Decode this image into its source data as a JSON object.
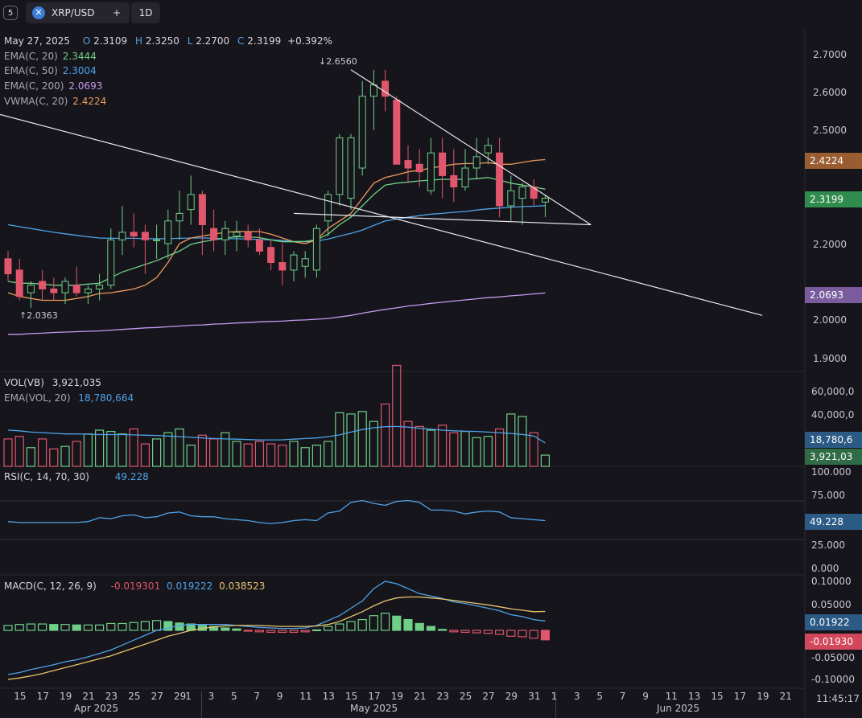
{
  "toolbar": {
    "layout_label": "5",
    "symbol": "XRP/USD",
    "add_label": "+",
    "interval": "1D"
  },
  "header": {
    "date": "May 27, 2025",
    "o_label": "O",
    "o": "2.3109",
    "h_label": "H",
    "h": "2.3250",
    "l_label": "L",
    "l": "2.2700",
    "c_label": "C",
    "c": "2.3199",
    "change": "+0.392%"
  },
  "indicators": [
    {
      "label": "EMA(C, 20)",
      "value": "2.3444",
      "color": "#6fcf86"
    },
    {
      "label": "EMA(C, 50)",
      "value": "2.3004",
      "color": "#4ea3e8"
    },
    {
      "label": "EMA(C, 200)",
      "value": "2.0693",
      "color": "#c59bf0"
    },
    {
      "label": "VWMA(C, 20)",
      "value": "2.4224",
      "color": "#ee9a5a"
    }
  ],
  "annotations": {
    "high": "↓2.6560",
    "low": "↑2.0363"
  },
  "price_axis": [
    "2.7000",
    "2.6000",
    "2.5000",
    "2.4000",
    "2.3000",
    "2.2000",
    "2.1000",
    "2.0000",
    "1.9000"
  ],
  "price_labels": [
    {
      "text": "2.4224",
      "color": "#9a5d31"
    },
    {
      "text": "2.3199",
      "color": "#2f8c4e"
    },
    {
      "text": "2.0693",
      "color": "#7a5c9e"
    }
  ],
  "volume": {
    "label": "VOL(VB)",
    "value": "3,921,035",
    "ema_label": "EMA(VOL, 20)",
    "ema_value": "18,780,664",
    "axis": [
      "60,000,0",
      "40,000,0"
    ],
    "tag_ema": "18,780,6",
    "tag_vol": "3,921,03",
    "tag_ema_color": "#2b5a85",
    "tag_vol_color": "#2f6b45"
  },
  "rsi": {
    "label": "RSI(C, 14, 70, 30)",
    "value": "49.228",
    "axis": [
      "100.000",
      "75.000",
      "50.000",
      "25.000",
      "0.000"
    ],
    "tag": "49.228",
    "tag_color": "#2b5a85"
  },
  "macd": {
    "label": "MACD(C, 12, 26, 9)",
    "v1": "-0.019301",
    "v2": "0.019222",
    "v3": "0.038523",
    "axis": [
      "0.10000",
      "0.05000",
      "0.00000",
      "-0.05000",
      "-0.10000"
    ],
    "tag_pos": "0.01922",
    "tag_neg": "-0.01930",
    "tag_pos_color": "#2b5a85",
    "tag_neg_color": "#d3475c"
  },
  "x_axis": {
    "days": [
      "15",
      "17",
      "19",
      "21",
      "23",
      "25",
      "27",
      "29",
      "1",
      "3",
      "5",
      "7",
      "9",
      "11",
      "13",
      "15",
      "17",
      "19",
      "21",
      "23",
      "25",
      "27",
      "29",
      "31",
      "1",
      "3",
      "5",
      "7",
      "9",
      "11",
      "13",
      "15",
      "17",
      "19",
      "21"
    ],
    "months": [
      "Apr 2025",
      "May 2025",
      "Jun 2025"
    ],
    "time": "11:45:17"
  },
  "colors": {
    "up": "#6fcf86",
    "down": "#e0566d",
    "trendline": "#e8e8ee"
  },
  "chart_data": {
    "type": "candlestick",
    "symbol": "XRP/USD",
    "interval": "1D",
    "x_start": "2025-04-14",
    "ohlc": [
      [
        2.16,
        2.18,
        2.1,
        2.12
      ],
      [
        2.13,
        2.16,
        2.05,
        2.06
      ],
      [
        2.07,
        2.1,
        2.03,
        2.09
      ],
      [
        2.1,
        2.13,
        2.05,
        2.08
      ],
      [
        2.08,
        2.11,
        2.05,
        2.07
      ],
      [
        2.07,
        2.11,
        2.04,
        2.1
      ],
      [
        2.09,
        2.14,
        2.06,
        2.07
      ],
      [
        2.07,
        2.09,
        2.04,
        2.08
      ],
      [
        2.08,
        2.12,
        2.05,
        2.09
      ],
      [
        2.09,
        2.24,
        2.08,
        2.21
      ],
      [
        2.21,
        2.3,
        2.17,
        2.23
      ],
      [
        2.23,
        2.28,
        2.19,
        2.22
      ],
      [
        2.23,
        2.25,
        2.12,
        2.21
      ],
      [
        2.21,
        2.25,
        2.16,
        2.21
      ],
      [
        2.2,
        2.29,
        2.16,
        2.26
      ],
      [
        2.26,
        2.34,
        2.21,
        2.28
      ],
      [
        2.29,
        2.38,
        2.25,
        2.33
      ],
      [
        2.33,
        2.34,
        2.17,
        2.25
      ],
      [
        2.24,
        2.29,
        2.18,
        2.21
      ],
      [
        2.21,
        2.26,
        2.17,
        2.24
      ],
      [
        2.22,
        2.26,
        2.18,
        2.23
      ],
      [
        2.23,
        2.25,
        2.19,
        2.21
      ],
      [
        2.21,
        2.24,
        2.17,
        2.18
      ],
      [
        2.19,
        2.21,
        2.13,
        2.15
      ],
      [
        2.15,
        2.2,
        2.09,
        2.13
      ],
      [
        2.13,
        2.18,
        2.1,
        2.17
      ],
      [
        2.14,
        2.18,
        2.11,
        2.16
      ],
      [
        2.13,
        2.25,
        2.11,
        2.24
      ],
      [
        2.26,
        2.34,
        2.22,
        2.33
      ],
      [
        2.33,
        2.49,
        2.3,
        2.48
      ],
      [
        2.32,
        2.49,
        2.29,
        2.48
      ],
      [
        2.4,
        2.63,
        2.38,
        2.59
      ],
      [
        2.59,
        2.66,
        2.5,
        2.62
      ],
      [
        2.63,
        2.66,
        2.55,
        2.59
      ],
      [
        2.58,
        2.59,
        2.41,
        2.41
      ],
      [
        2.42,
        2.46,
        2.36,
        2.4
      ],
      [
        2.41,
        2.45,
        2.35,
        2.39
      ],
      [
        2.34,
        2.48,
        2.33,
        2.44
      ],
      [
        2.44,
        2.48,
        2.32,
        2.38
      ],
      [
        2.38,
        2.45,
        2.31,
        2.35
      ],
      [
        2.35,
        2.45,
        2.34,
        2.4
      ],
      [
        2.4,
        2.48,
        2.37,
        2.43
      ],
      [
        2.44,
        2.48,
        2.41,
        2.46
      ],
      [
        2.44,
        2.48,
        2.27,
        2.3
      ],
      [
        2.3,
        2.38,
        2.26,
        2.34
      ],
      [
        2.32,
        2.36,
        2.25,
        2.35
      ],
      [
        2.35,
        2.37,
        2.3,
        2.32
      ],
      [
        2.31,
        2.33,
        2.27,
        2.32
      ]
    ],
    "overlays": {
      "ema20": [
        2.1,
        2.095,
        2.095,
        2.093,
        2.09,
        2.09,
        2.09,
        2.093,
        2.095,
        2.11,
        2.125,
        2.135,
        2.145,
        2.155,
        2.168,
        2.18,
        2.198,
        2.205,
        2.21,
        2.215,
        2.218,
        2.218,
        2.216,
        2.21,
        2.205,
        2.205,
        2.206,
        2.21,
        2.225,
        2.25,
        2.27,
        2.3,
        2.33,
        2.355,
        2.36,
        2.363,
        2.366,
        2.368,
        2.37,
        2.37,
        2.37,
        2.372,
        2.375,
        2.368,
        2.36,
        2.355,
        2.35,
        2.344
      ],
      "ema50": [
        2.25,
        2.245,
        2.24,
        2.235,
        2.23,
        2.226,
        2.222,
        2.218,
        2.215,
        2.214,
        2.214,
        2.214,
        2.213,
        2.213,
        2.213,
        2.214,
        2.215,
        2.215,
        2.214,
        2.213,
        2.213,
        2.212,
        2.211,
        2.21,
        2.208,
        2.206,
        2.205,
        2.207,
        2.212,
        2.22,
        2.227,
        2.236,
        2.248,
        2.26,
        2.265,
        2.27,
        2.274,
        2.278,
        2.28,
        2.283,
        2.285,
        2.289,
        2.292,
        2.294,
        2.296,
        2.298,
        2.299,
        2.3004
      ],
      "ema200": [
        1.96,
        1.96,
        1.962,
        1.963,
        1.965,
        1.966,
        1.967,
        1.968,
        1.969,
        1.971,
        1.973,
        1.975,
        1.977,
        1.978,
        1.98,
        1.982,
        1.984,
        1.985,
        1.987,
        1.988,
        1.99,
        1.991,
        1.993,
        1.994,
        1.995,
        1.997,
        1.998,
        2.0,
        2.002,
        2.006,
        2.01,
        2.016,
        2.021,
        2.026,
        2.03,
        2.035,
        2.038,
        2.042,
        2.045,
        2.048,
        2.051,
        2.054,
        2.057,
        2.059,
        2.062,
        2.064,
        2.067,
        2.0693
      ],
      "vwma20": [
        2.07,
        2.06,
        2.055,
        2.05,
        2.05,
        2.05,
        2.055,
        2.06,
        2.068,
        2.07,
        2.075,
        2.08,
        2.09,
        2.11,
        2.15,
        2.2,
        2.215,
        2.22,
        2.225,
        2.23,
        2.232,
        2.232,
        2.232,
        2.225,
        2.215,
        2.205,
        2.2,
        2.21,
        2.24,
        2.26,
        2.28,
        2.32,
        2.36,
        2.375,
        2.382,
        2.39,
        2.394,
        2.4,
        2.405,
        2.41,
        2.412,
        2.412,
        2.414,
        2.41,
        2.41,
        2.415,
        2.42,
        2.4224
      ]
    },
    "trendlines": [
      {
        "from": [
          "2025-04-06",
          2.6
        ],
        "to": [
          "2025-06-19",
          2.01
        ]
      },
      {
        "from": [
          "2025-05-14",
          2.66
        ],
        "to": [
          "2025-06-04",
          2.25
        ]
      },
      {
        "from": [
          "2025-05-09",
          2.28
        ],
        "to": [
          "2025-06-04",
          2.25
        ]
      }
    ],
    "volume": [
      22,
      24,
      15,
      22,
      14,
      16,
      20,
      26,
      29,
      28,
      26,
      30,
      18,
      22,
      27,
      30,
      17,
      25,
      22,
      27,
      20,
      18,
      20,
      18,
      17,
      20,
      15,
      17,
      20,
      43,
      42,
      44,
      36,
      50,
      81,
      36,
      32,
      29,
      33,
      27,
      28,
      23,
      24,
      30,
      42,
      40,
      27,
      9
    ],
    "volume_ema": [
      29,
      28.5,
      27.5,
      27,
      26.5,
      26,
      26,
      25.8,
      25.5,
      25.5,
      25.5,
      25.2,
      25,
      24.8,
      24.3,
      23.8,
      23.3,
      22.8,
      22.3,
      22,
      21.8,
      21.5,
      21.2,
      21.2,
      21.3,
      21.8,
      22.3,
      22.8,
      23.8,
      25.2,
      27.5,
      29.5,
      31,
      31.8,
      32,
      31.5,
      30.5,
      29.8,
      29,
      28.5,
      28.2,
      28,
      27.5,
      27,
      26.3,
      25.6,
      24.4,
      18.78
    ],
    "volume_unit": "millions",
    "rsi": [
      49,
      48,
      48,
      48,
      48,
      48,
      48,
      49,
      53,
      52,
      55,
      56,
      53,
      54,
      58,
      59,
      55,
      54,
      54,
      52,
      51,
      50,
      48,
      47,
      48,
      50,
      51,
      50,
      58,
      60,
      69,
      71,
      68,
      66,
      70,
      71,
      69,
      61,
      61,
      60,
      57,
      59,
      60,
      59,
      53,
      52,
      51,
      50,
      49.2
    ],
    "macd": [
      -0.09,
      -0.086,
      -0.08,
      -0.075,
      -0.07,
      -0.064,
      -0.06,
      -0.054,
      -0.047,
      -0.04,
      -0.03,
      -0.02,
      -0.01,
      0,
      0.005,
      0.01,
      0.012,
      0.012,
      0.012,
      0.012,
      0.01,
      0.008,
      0.006,
      0.005,
      0.004,
      0.004,
      0.005,
      0.01,
      0.02,
      0.03,
      0.045,
      0.06,
      0.085,
      0.1,
      0.095,
      0.085,
      0.075,
      0.07,
      0.065,
      0.058,
      0.055,
      0.05,
      0.045,
      0.04,
      0.032,
      0.028,
      0.022,
      0.0192
    ],
    "macd_signal": [
      -0.1,
      -0.097,
      -0.093,
      -0.088,
      -0.082,
      -0.076,
      -0.07,
      -0.064,
      -0.058,
      -0.052,
      -0.044,
      -0.036,
      -0.028,
      -0.02,
      -0.012,
      -0.006,
      0,
      0.004,
      0.007,
      0.009,
      0.01,
      0.01,
      0.01,
      0.009,
      0.008,
      0.008,
      0.008,
      0.009,
      0.012,
      0.018,
      0.028,
      0.038,
      0.05,
      0.06,
      0.066,
      0.068,
      0.068,
      0.066,
      0.064,
      0.061,
      0.058,
      0.055,
      0.052,
      0.048,
      0.044,
      0.041,
      0.038,
      0.0385
    ],
    "macd_hist": [
      0.01,
      0.012,
      0.013,
      0.013,
      0.012,
      0.012,
      0.011,
      0.011,
      0.011,
      0.014,
      0.014,
      0.016,
      0.018,
      0.02,
      0.018,
      0.015,
      0.013,
      0.01,
      0.008,
      0.005,
      0.003,
      -0.001,
      -0.003,
      -0.004,
      -0.004,
      -0.004,
      -0.003,
      0.001,
      0.008,
      0.013,
      0.018,
      0.022,
      0.03,
      0.035,
      0.029,
      0.022,
      0.014,
      0.008,
      0.002,
      -0.003,
      -0.004,
      -0.005,
      -0.006,
      -0.008,
      -0.012,
      -0.013,
      -0.016,
      -0.0193
    ],
    "price_range": [
      1.86,
      2.74
    ],
    "rsi_levels": [
      70,
      30
    ]
  }
}
